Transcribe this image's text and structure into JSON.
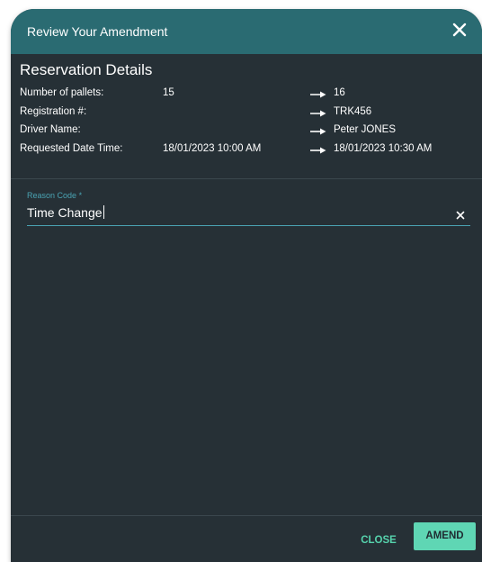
{
  "dialog": {
    "title": "Review Your Amendment"
  },
  "details": {
    "heading": "Reservation Details",
    "rows": [
      {
        "label": "Number of pallets:",
        "old": "15",
        "new": "16"
      },
      {
        "label": "Registration #:",
        "old": "",
        "new": "TRK456"
      },
      {
        "label": "Driver Name:",
        "old": "",
        "new": "Peter JONES"
      },
      {
        "label": "Requested Date Time:",
        "old": "18/01/2023 10:00 AM",
        "new": "18/01/2023 10:30 AM"
      }
    ]
  },
  "reason": {
    "label": "Reason Code",
    "required_mark": "*",
    "value": "Time Change"
  },
  "footer": {
    "close_label": "CLOSE",
    "amend_label": "AMEND"
  },
  "colors": {
    "header": "#2a6b72",
    "background": "#263036",
    "accent": "#5fd6b4",
    "field_accent": "#4aa3b3"
  },
  "icons": {
    "dialog_close": "close-icon",
    "row_arrow": "arrow-right-icon",
    "clear": "clear-icon"
  }
}
